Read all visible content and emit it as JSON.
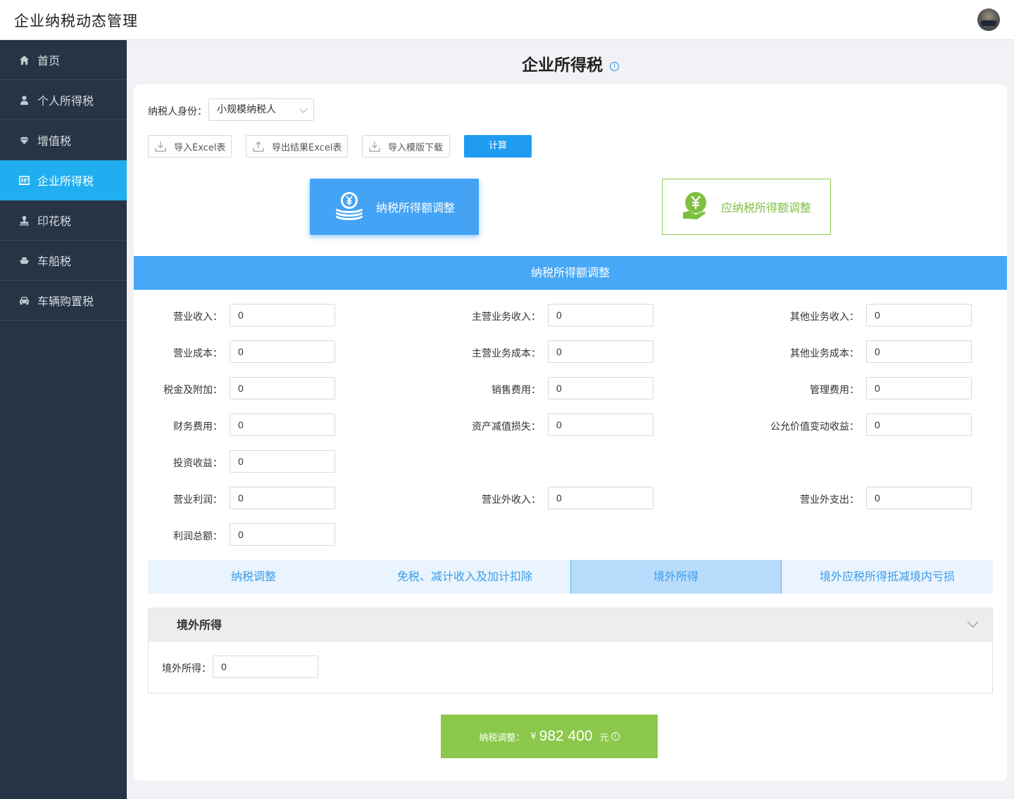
{
  "app": {
    "title": "企业纳税动态管理"
  },
  "sidebar": {
    "items": [
      {
        "label": "首页",
        "icon": "home-icon"
      },
      {
        "label": "个人所得税",
        "icon": "person-icon"
      },
      {
        "label": "增值税",
        "icon": "diamond-icon"
      },
      {
        "label": "企业所得税",
        "icon": "building-icon",
        "active": true
      },
      {
        "label": "印花税",
        "icon": "stamp-icon"
      },
      {
        "label": "车船税",
        "icon": "ship-icon"
      },
      {
        "label": "车辆购置税",
        "icon": "car-icon"
      }
    ]
  },
  "page": {
    "title": "企业所得税",
    "info_glyph": "i"
  },
  "identity": {
    "label": "纳税人身份：",
    "value": "小规模纳税人"
  },
  "toolbar": {
    "import_excel": "导入Excel表",
    "export_excel": "导出结果Excel表",
    "download_template": "导入模版下载",
    "calculate": "计算"
  },
  "cards": {
    "taxable_adjust": "纳税所得额调整",
    "payable_adjust": "应纳税所得额调整"
  },
  "section": {
    "title": "纳税所得额调整"
  },
  "fields": {
    "revenue": {
      "label": "营业收入：",
      "value": "0"
    },
    "main_revenue": {
      "label": "主营业务收入：",
      "value": "0"
    },
    "other_revenue": {
      "label": "其他业务收入：",
      "value": "0"
    },
    "cost": {
      "label": "营业成本：",
      "value": "0"
    },
    "main_cost": {
      "label": "主营业务成本：",
      "value": "0"
    },
    "other_cost": {
      "label": "其他业务成本：",
      "value": "0"
    },
    "tax_surcharge": {
      "label": "税金及附加：",
      "value": "0"
    },
    "selling_expense": {
      "label": "销售费用：",
      "value": "0"
    },
    "admin_expense": {
      "label": "管理费用：",
      "value": "0"
    },
    "finance_expense": {
      "label": "财务费用：",
      "value": "0"
    },
    "impairment_loss": {
      "label": "资产减值损失：",
      "value": "0"
    },
    "fair_value_gain": {
      "label": "公允价值变动收益：",
      "value": "0"
    },
    "investment_income": {
      "label": "投资收益：",
      "value": "0"
    },
    "operating_profit": {
      "label": "营业利润：",
      "value": "0"
    },
    "non_op_income": {
      "label": "营业外收入：",
      "value": "0"
    },
    "non_op_expense": {
      "label": "营业外支出：",
      "value": "0"
    },
    "total_profit": {
      "label": "利润总额：",
      "value": "0"
    }
  },
  "tabs": [
    {
      "label": "纳税调整"
    },
    {
      "label": "免税、减计收入及加计扣除"
    },
    {
      "label": "境外所得",
      "active": true
    },
    {
      "label": "境外应税所得抵减境内亏损"
    }
  ],
  "foreign": {
    "title": "境外所得",
    "field_label": "境外所得：",
    "field_value": "0"
  },
  "result": {
    "label": "纳税调整：",
    "currency": "¥",
    "value": "982 400",
    "unit": "元",
    "info_glyph": "i"
  },
  "colors": {
    "sidebar_bg": "#263445",
    "active_blue": "#1faeef",
    "section_blue": "#46a8f7",
    "result_green": "#8cc84b"
  }
}
